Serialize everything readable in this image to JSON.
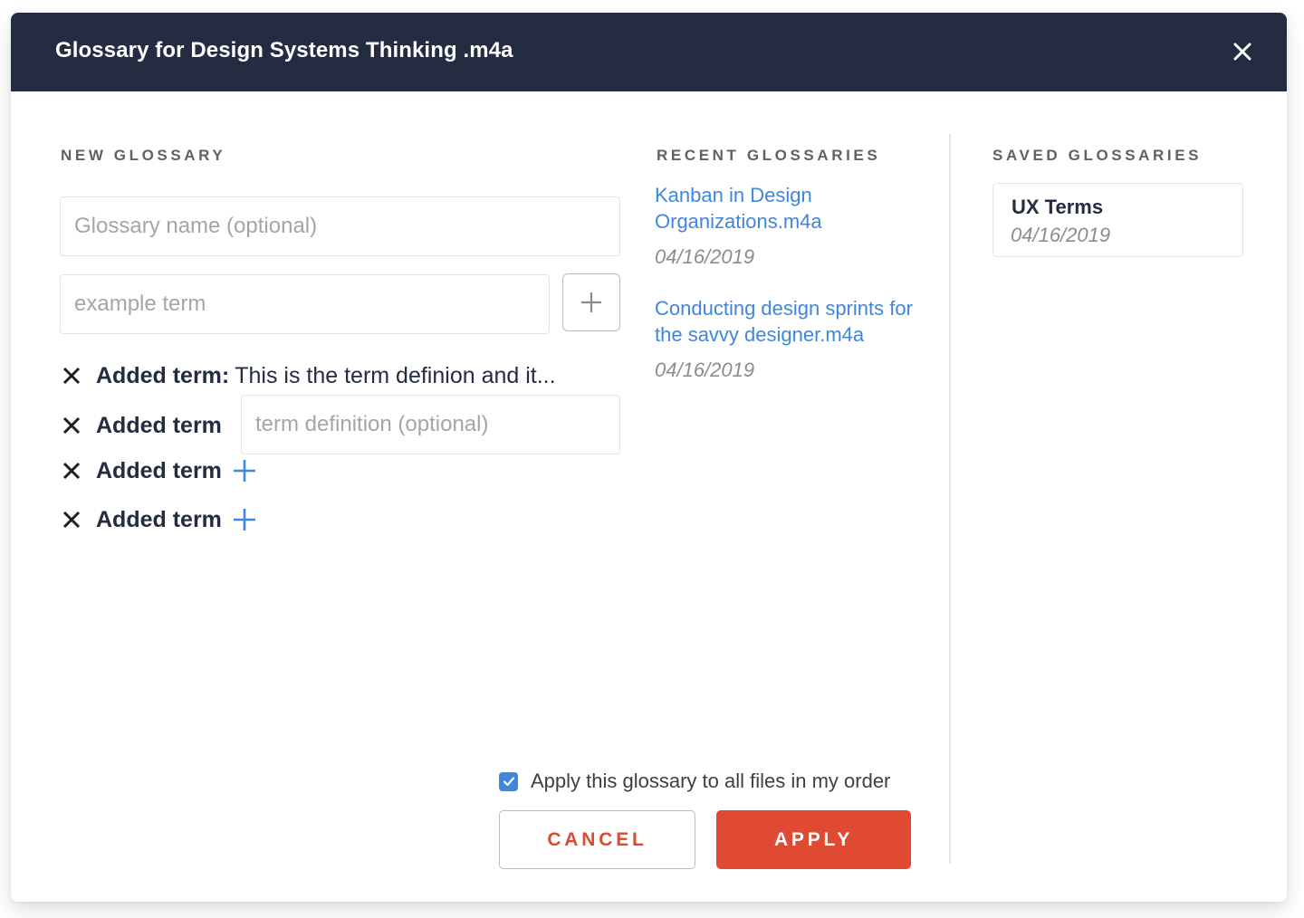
{
  "dialog": {
    "title": "Glossary for Design Systems Thinking .m4a",
    "close_icon": "close-icon"
  },
  "new_glossary": {
    "heading": "NEW GLOSSARY",
    "name_input": {
      "value": "",
      "placeholder": "Glossary name (optional)"
    },
    "term_input": {
      "value": "",
      "placeholder": "example term"
    },
    "add_term_icon": "plus-icon",
    "terms": [
      {
        "name": "Added term:",
        "definition": "This is the term definion and it...",
        "state": "defined"
      },
      {
        "name": "Added term",
        "definition_input": {
          "value": "",
          "placeholder": "term definition (optional)"
        },
        "state": "editing"
      },
      {
        "name": "Added term",
        "state": "empty",
        "add_icon": "plus-icon"
      },
      {
        "name": "Added term",
        "state": "empty",
        "add_icon": "plus-icon"
      }
    ],
    "remove_icon": "x-icon"
  },
  "recent_glossaries": {
    "heading": "RECENT GLOSSARIES",
    "items": [
      {
        "name": "Kanban in Design Organizations.m4a",
        "date": "04/16/2019"
      },
      {
        "name": "Conducting design sprints for the savvy designer.m4a",
        "date": "04/16/2019"
      }
    ]
  },
  "saved_glossaries": {
    "heading": "SAVED GLOSSARIES",
    "items": [
      {
        "name": "UX Terms",
        "date": "04/16/2019"
      }
    ]
  },
  "footer": {
    "apply_all": {
      "label": "Apply this glossary to all files in my order",
      "checked": true
    },
    "cancel_label": "CANCEL",
    "apply_label": "APPLY"
  },
  "colors": {
    "header_bg": "#232c40",
    "link": "#3f86dc",
    "accent": "#e04a32",
    "checkbox": "#3f86dc"
  }
}
